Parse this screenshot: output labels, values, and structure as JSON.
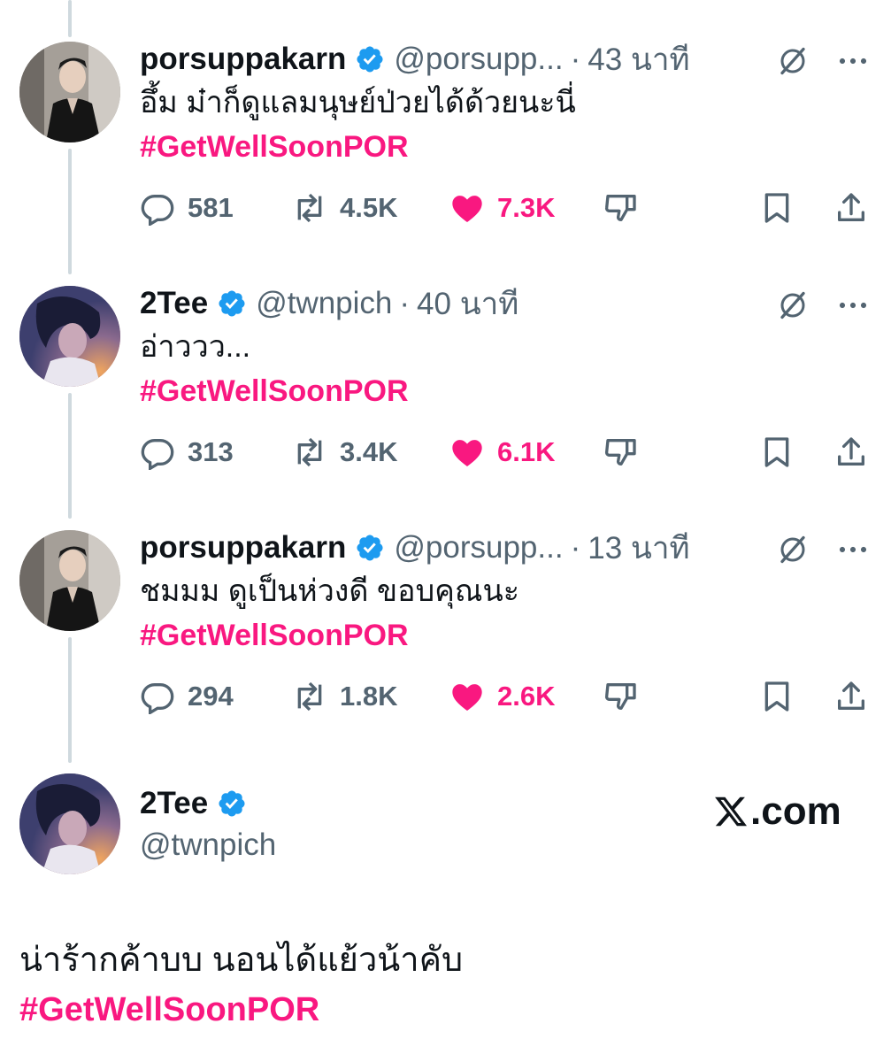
{
  "tweets": [
    {
      "author": "porsuppakarn",
      "handle": "@porsupp...",
      "dot": "·",
      "time": "43 นาที",
      "text": "อึ้ม ม๋าก็ดูแลมนุษย์ป่วยได้ด้วยนะนี่",
      "hashtag": "#GetWellSoonPOR",
      "replies": "581",
      "reposts": "4.5K",
      "likes": "7.3K",
      "liked": true,
      "avatar_style": "porsuppakarn"
    },
    {
      "author": "2Tee",
      "handle": "@twnpich",
      "dot": "·",
      "time": "40 นาที",
      "text": "อ่าววว...",
      "hashtag": "#GetWellSoonPOR",
      "replies": "313",
      "reposts": "3.4K",
      "likes": "6.1K",
      "liked": true,
      "avatar_style": "2tee"
    },
    {
      "author": "porsuppakarn",
      "handle": "@porsupp...",
      "dot": "·",
      "time": "13 นาที",
      "text": "ชมมม ดูเป็นห่วงดี ขอบคุณนะ",
      "hashtag": "#GetWellSoonPOR",
      "replies": "294",
      "reposts": "1.8K",
      "likes": "2.6K",
      "liked": true,
      "avatar_style": "porsuppakarn"
    }
  ],
  "final_tweet": {
    "author": "2Tee",
    "handle": "@twnpich",
    "source": ".com",
    "text": "น่าร้ากค้าบบ นอนได้แย้วน้าคับ",
    "hashtag": "#GetWellSoonPOR"
  },
  "colors": {
    "like_pink": "#f91880",
    "verified_blue": "#1d9bf0",
    "secondary_gray": "#536471",
    "thread_line": "#cfd9de"
  },
  "icons": [
    "verified-badge-icon",
    "grok-icon",
    "more-icon",
    "reply-icon",
    "repost-icon",
    "like-icon",
    "dislike-icon",
    "bookmark-icon",
    "share-icon",
    "x-logo-icon"
  ]
}
